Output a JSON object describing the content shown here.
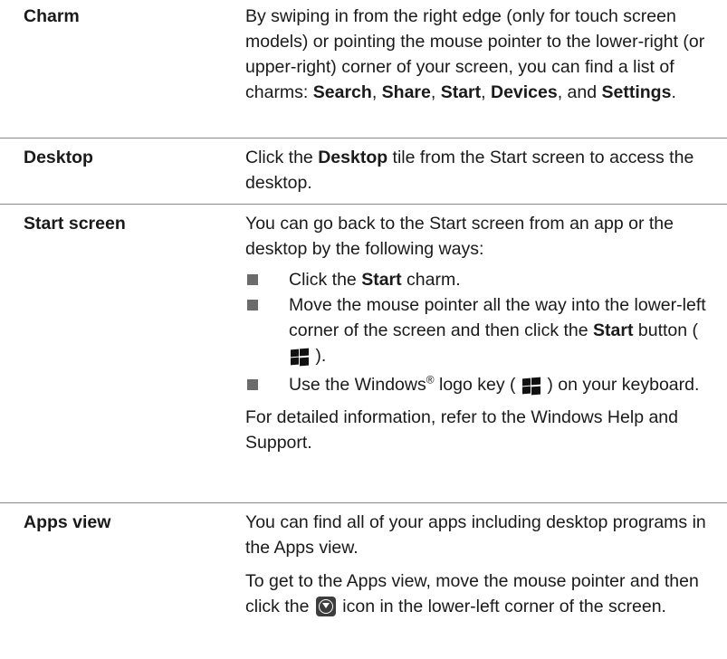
{
  "rows": [
    {
      "term": "Charm",
      "desc": {
        "t1": "By swiping in from the right edge (only for touch screen models) or pointing the mouse pointer to the lower-right (or upper-right) corner of your screen, you can find a list of charms: ",
        "b1": "Search",
        "t2": ", ",
        "b2": "Share",
        "t3": ", ",
        "b3": "Start",
        "t4": ", ",
        "b4": "Devices",
        "t5": ", and ",
        "b5": "Settings",
        "t6": "."
      }
    },
    {
      "term": "Desktop",
      "desc": {
        "t1": "Click the ",
        "b1": "Desktop",
        "t2": " tile from the Start screen to access the desktop."
      }
    },
    {
      "term": "Start screen",
      "intro": "You can go back to the Start screen from an app or the desktop by the following ways:",
      "bullets": [
        {
          "t1": "Click the ",
          "b1": "Start",
          "t2": " charm."
        },
        {
          "t1": "Move the mouse pointer all the way into the lower-left corner of the screen and then click the ",
          "b1": "Start",
          "t2": " button ( ",
          "t3": " )."
        },
        {
          "t1": "Use the Windows",
          "sup": "®",
          "t2": " logo key ( ",
          "t3": " ) on your keyboard."
        }
      ],
      "outro": "For detailed information, refer to the Windows Help and Support."
    },
    {
      "term": "Apps view",
      "p1": "You can find all of your apps including desktop programs in the Apps view.",
      "p2": {
        "t1": "To get to the Apps view, move the mouse pointer and then click the ",
        "t2": " icon in the lower-left corner of the screen."
      }
    }
  ],
  "icons": {
    "windows_logo": "windows-logo-icon",
    "apps_arrow": "apps-arrow-icon"
  },
  "colors": {
    "text": "#1a1a1a",
    "divider": "#8a8a8a",
    "bullet": "#6b6b6b"
  }
}
